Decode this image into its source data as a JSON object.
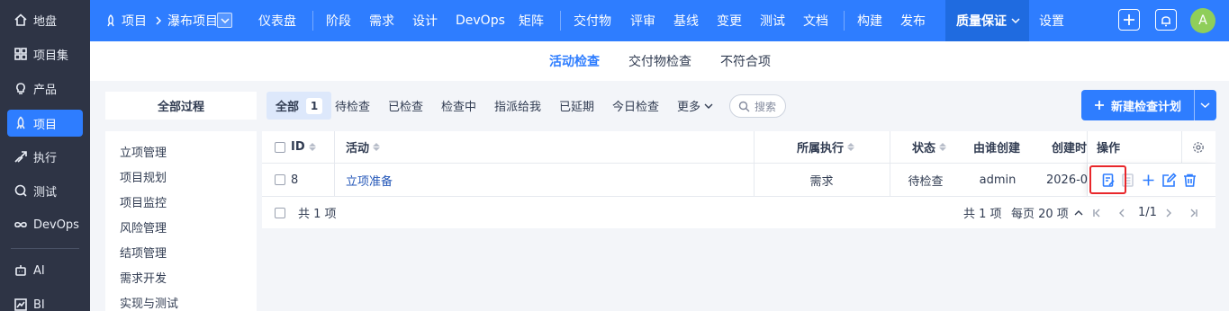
{
  "sidebar": {
    "items": [
      {
        "label": "地盘",
        "icon": "home-icon"
      },
      {
        "label": "项目集",
        "icon": "grid-icon"
      },
      {
        "label": "产品",
        "icon": "lightbulb-icon"
      },
      {
        "label": "项目",
        "icon": "rocket-icon",
        "active": true
      },
      {
        "label": "执行",
        "icon": "run-icon"
      },
      {
        "label": "测试",
        "icon": "search-bug-icon"
      },
      {
        "label": "DevOps",
        "icon": "infinity-icon"
      },
      {
        "label": "AI",
        "icon": "robot-icon"
      },
      {
        "label": "BI",
        "icon": "chart-icon"
      }
    ]
  },
  "topnav": {
    "crumb_root": "项目",
    "crumb_project": "瀑布项目",
    "items": [
      "仪表盘",
      "阶段",
      "需求",
      "设计",
      "DevOps",
      "矩阵",
      "交付物",
      "评审",
      "基线",
      "变更",
      "测试",
      "文档",
      "构建",
      "发布",
      "质量保证",
      "设置"
    ],
    "active": "质量保证",
    "avatar_letter": "A",
    "accent": "#2e7dff"
  },
  "subnav": {
    "tabs": [
      "活动检查",
      "交付物检查",
      "不符合项"
    ],
    "active": "活动检查"
  },
  "process": {
    "title": "全部过程",
    "items": [
      "立项管理",
      "项目规划",
      "项目监控",
      "风险管理",
      "结项管理",
      "需求开发",
      "实现与测试"
    ]
  },
  "filters": {
    "all_label": "全部",
    "all_count": "1",
    "tabs": [
      "待检查",
      "已检查",
      "检查中",
      "指派给我",
      "已延期",
      "今日检查",
      "更多"
    ],
    "search_placeholder": "搜索",
    "new_button": "新建检查计划"
  },
  "table": {
    "headers": {
      "id": "ID",
      "activity": "活动",
      "execution": "所属执行",
      "status": "状态",
      "creator": "由谁创建",
      "created": "创建时",
      "actions": "操作"
    },
    "rows": [
      {
        "id": "8",
        "activity": "立项准备",
        "execution": "需求",
        "status": "待检查",
        "creator": "admin",
        "created": "2026-0"
      }
    ],
    "footer": {
      "total_left": "共 1 项",
      "total_right": "共 1 项",
      "per_page": "每页 20 项",
      "page": "1/1"
    }
  },
  "colors": {
    "highlight": "#e8262a"
  }
}
